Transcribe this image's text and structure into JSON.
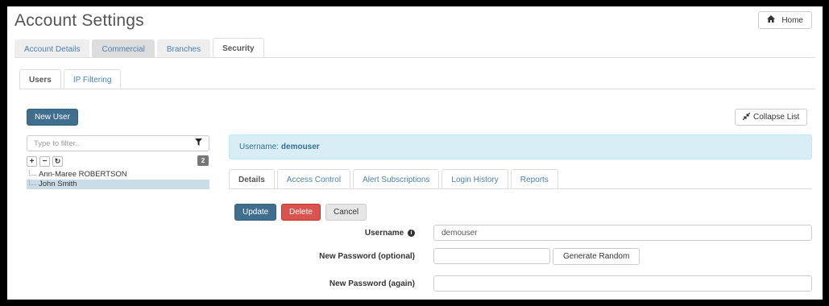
{
  "page": {
    "title": "Account Settings",
    "home_label": "Home"
  },
  "main_tabs": [
    {
      "label": "Account Details"
    },
    {
      "label": "Commercial"
    },
    {
      "label": "Branches"
    },
    {
      "label": "Security"
    }
  ],
  "sub_tabs": [
    {
      "label": "Users"
    },
    {
      "label": "IP Filtering"
    }
  ],
  "users_panel": {
    "new_user_label": "New User",
    "collapse_list_label": "Collapse List",
    "filter_placeholder": "Type to filter..",
    "count": "2",
    "expand_symbol": "+",
    "collapse_symbol": "−",
    "refresh_symbol": "↻",
    "users": [
      {
        "name": "Ann-Maree ROBERTSON"
      },
      {
        "name": "John Smith"
      }
    ]
  },
  "detail": {
    "username_prefix": "Username:",
    "username_value": "demouser",
    "tabs": [
      {
        "label": "Details"
      },
      {
        "label": "Access Control"
      },
      {
        "label": "Alert Subscriptions"
      },
      {
        "label": "Login History"
      },
      {
        "label": "Reports"
      }
    ],
    "update_label": "Update",
    "delete_label": "Delete",
    "cancel_label": "Cancel",
    "form": {
      "username_label": "Username",
      "username_value": "demouser",
      "new_password_label": "New Password (optional)",
      "new_password_value": "",
      "generate_label": "Generate Random",
      "new_password_again_label": "New Password (again)",
      "new_password_again_value": ""
    }
  },
  "icons": {
    "home": "home-icon",
    "filter": "filter-icon",
    "collapse": "compress-icon",
    "info": "info-circle-icon"
  }
}
